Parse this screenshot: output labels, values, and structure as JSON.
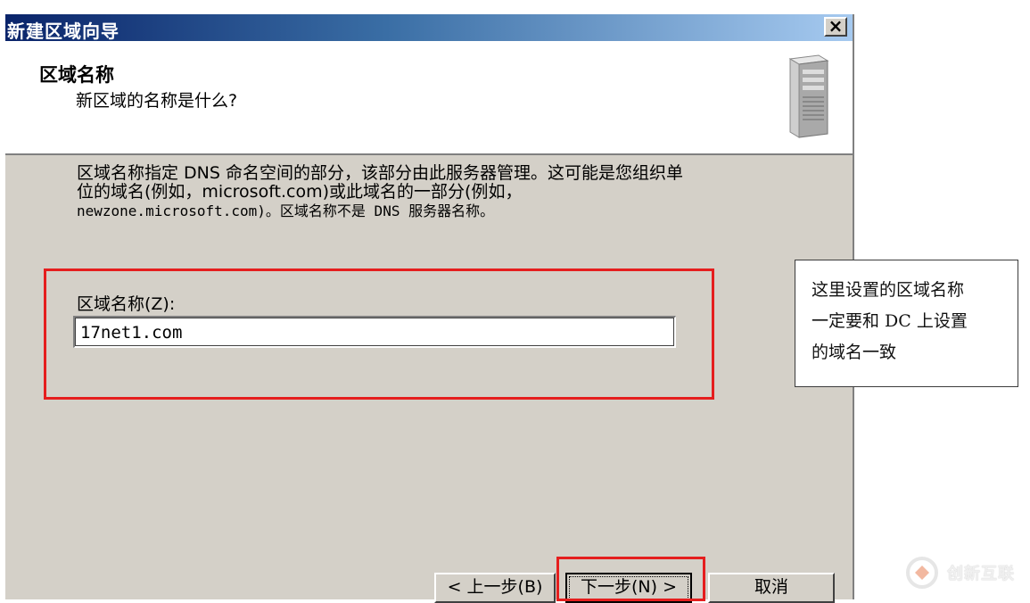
{
  "window": {
    "title": "新建区域向导",
    "close_label": "×"
  },
  "header": {
    "title": "区域名称",
    "subtitle": "新区域的名称是什么?",
    "icon": "server-icon"
  },
  "description": {
    "line1": "区域名称指定 DNS 命名空间的部分，该部分由此服务器管理。这可能是您组织单",
    "line2": "位的域名(例如，microsoft.com)或此域名的一部分(例如，",
    "line3": "newzone.microsoft.com)。区域名称不是 DNS 服务器名称。"
  },
  "zone_name": {
    "label": "区域名称(Z):",
    "value": "17net1.com"
  },
  "buttons": {
    "back": "< 上一步(B)",
    "next": "下一步(N) >",
    "cancel": "取消"
  },
  "annotation": {
    "line1": "这里设置的区域名称",
    "line2": "一定要和 DC 上设置",
    "line3": "的域名一致"
  },
  "watermark": {
    "text": "创新互联"
  },
  "colors": {
    "highlight": "#e51e1e",
    "dialog_bg": "#d4d0c8",
    "title_start": "#0a246a",
    "title_end": "#a6caf0"
  }
}
